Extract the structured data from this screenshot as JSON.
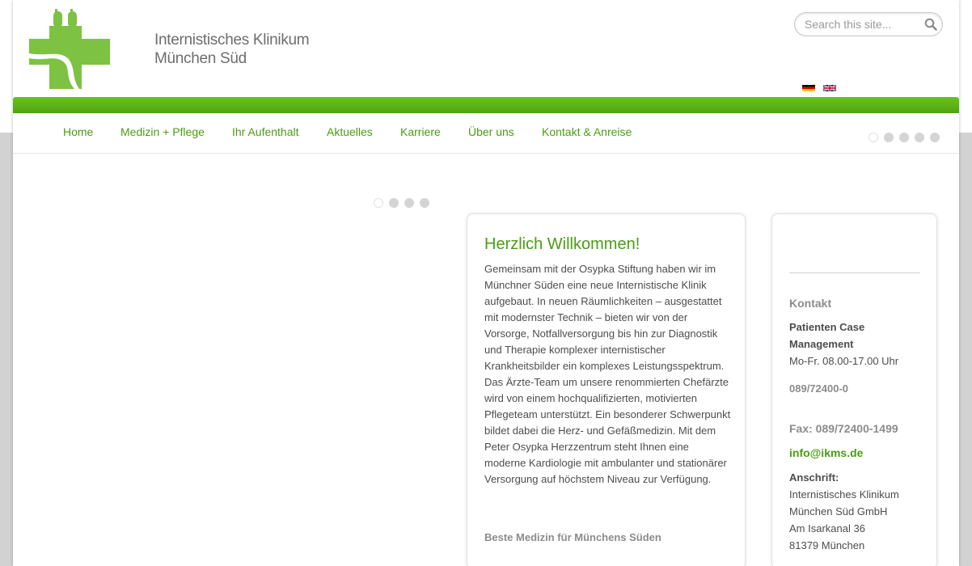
{
  "header": {
    "logo_line1": "Internistisches Klinikum",
    "logo_line2": "München Süd",
    "search_placeholder": "Search this site...",
    "languages": [
      "de",
      "en"
    ]
  },
  "colors": {
    "brand_green": "#4a9d12",
    "bar_green": "#5cb318",
    "logo_green": "#7dc242"
  },
  "nav": {
    "items": [
      {
        "label": "Home"
      },
      {
        "label": "Medizin + Pflege"
      },
      {
        "label": "Ihr Aufenthalt"
      },
      {
        "label": "Aktuelles"
      },
      {
        "label": "Karriere"
      },
      {
        "label": "Über uns"
      },
      {
        "label": "Kontakt & Anreise"
      }
    ],
    "slider_dots_count": 5,
    "slider_active_index": 0
  },
  "slider": {
    "dots_count": 4,
    "active_index": 0
  },
  "welcome": {
    "title": "Herzlich Willkommen!",
    "body": "Gemeinsam mit der Osypka Stiftung haben wir im Münchner Süden eine neue Internistische Klinik aufgebaut. In neuen Räumlichkeiten – ausgestattet mit modernster Technik – bieten wir von der Vorsorge, Notfallversorgung bis hin zur Diagnostik und Therapie komplexer internistischer Krankheitsbilder ein komplexes Leistungsspektrum. Das Ärzte-Team um unsere renommierten Chefärzte wird von einem hochqualifizierten, motivierten Pflegeteam unterstützt. Ein besonderer Schwerpunkt bildet dabei die Herz- und Gefäßmedizin. Mit dem Peter Osypka Herzzentrum steht Ihnen eine moderne Kardiologie mit ambulanter und stationärer Versorgung auf höchstem Niveau zur Verfügung.",
    "tagline": "Beste Medizin für Münchens Süden"
  },
  "contact": {
    "heading": "Kontakt",
    "department": "Patienten Case Management",
    "hours": "Mo-Fr. 08.00-17.00 Uhr",
    "phone": "089/72400-0",
    "fax": "Fax: 089/72400-1499",
    "email": "info@ikms.de",
    "address_label": "Anschrift:",
    "address": [
      "Internistisches Klinikum",
      "München Süd GmbH",
      "Am Isarkanal 36",
      "81379 München"
    ]
  }
}
